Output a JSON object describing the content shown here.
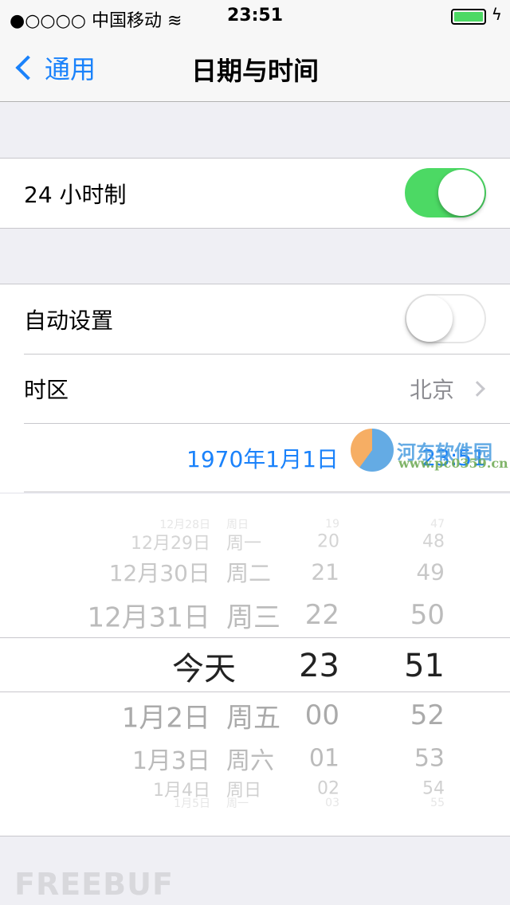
{
  "status": {
    "signal": "●○○○○",
    "carrier": "中国移动",
    "time": "23:51",
    "battery_level": 1.0
  },
  "nav": {
    "back_label": "通用",
    "title": "日期与时间"
  },
  "section1": {
    "label": "24 小时制",
    "toggle_on": true
  },
  "section2": {
    "auto_label": "自动设置",
    "auto_on": false,
    "timezone_label": "时区",
    "timezone_value": "北京",
    "date_value": "1970年1月1日",
    "time_value": "23:51"
  },
  "picker": {
    "rows": [
      {
        "date": "12月28日",
        "weekday": "周日",
        "hour": "19",
        "minute": "47"
      },
      {
        "date": "12月29日",
        "weekday": "周一",
        "hour": "20",
        "minute": "48"
      },
      {
        "date": "12月30日",
        "weekday": "周二",
        "hour": "21",
        "minute": "49"
      },
      {
        "date": "12月31日",
        "weekday": "周三",
        "hour": "22",
        "minute": "50"
      },
      {
        "date": "今天",
        "weekday": "",
        "hour": "23",
        "minute": "51"
      },
      {
        "date": "1月2日",
        "weekday": "周五",
        "hour": "00",
        "minute": "52"
      },
      {
        "date": "1月3日",
        "weekday": "周六",
        "hour": "01",
        "minute": "53"
      },
      {
        "date": "1月4日",
        "weekday": "周日",
        "hour": "02",
        "minute": "54"
      },
      {
        "date": "1月5日",
        "weekday": "周一",
        "hour": "03",
        "minute": "55"
      }
    ]
  },
  "watermarks": {
    "site_name": "河东软件园",
    "site_url": "www.pc0359.cn",
    "brand": "FREEBUF"
  },
  "colors": {
    "accent": "#1a82fb",
    "toggle_on": "#4cd964"
  }
}
